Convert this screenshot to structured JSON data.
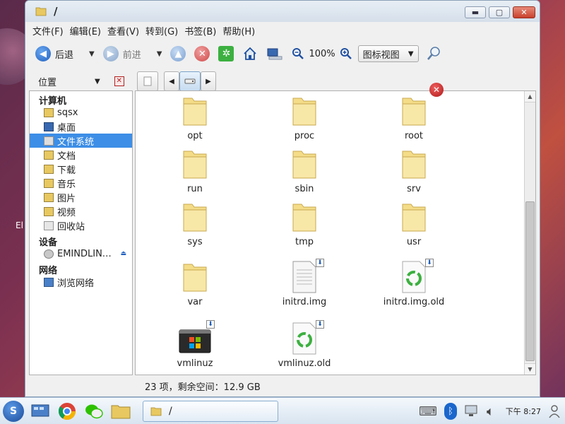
{
  "desktop": {
    "label": "El"
  },
  "window": {
    "title": "/",
    "controls": {
      "minimize": "▬",
      "maximize": "▢",
      "close": "✕"
    }
  },
  "menu": {
    "items": [
      "文件(F)",
      "编辑(E)",
      "查看(V)",
      "转到(G)",
      "书签(B)",
      "帮助(H)"
    ]
  },
  "toolbar": {
    "back_label": "后退",
    "forward_label": "前进",
    "zoom_level": "100%",
    "view_mode": "图标视图"
  },
  "location": {
    "label": "位置"
  },
  "sidebar": {
    "sections": [
      {
        "header": "计算机",
        "items": [
          {
            "label": "sqsx",
            "icon": "home-folder-icon"
          },
          {
            "label": "桌面",
            "icon": "desktop-icon"
          },
          {
            "label": "文件系统",
            "icon": "drive-icon",
            "selected": true
          },
          {
            "label": "文档",
            "icon": "documents-folder-icon"
          },
          {
            "label": "下载",
            "icon": "downloads-folder-icon"
          },
          {
            "label": "音乐",
            "icon": "music-folder-icon"
          },
          {
            "label": "图片",
            "icon": "pictures-folder-icon"
          },
          {
            "label": "视频",
            "icon": "videos-folder-icon"
          },
          {
            "label": "回收站",
            "icon": "trash-icon"
          }
        ]
      },
      {
        "header": "设备",
        "items": [
          {
            "label": "EMINDLIN…",
            "icon": "cdrom-icon",
            "eject": true
          }
        ]
      },
      {
        "header": "网络",
        "items": [
          {
            "label": "浏览网络",
            "icon": "network-icon"
          }
        ]
      }
    ]
  },
  "files": [
    {
      "name": "opt",
      "type": "folder"
    },
    {
      "name": "proc",
      "type": "folder"
    },
    {
      "name": "root",
      "type": "folder",
      "badge": "no-access"
    },
    {
      "name": "run",
      "type": "folder"
    },
    {
      "name": "sbin",
      "type": "folder"
    },
    {
      "name": "srv",
      "type": "folder"
    },
    {
      "name": "sys",
      "type": "folder"
    },
    {
      "name": "tmp",
      "type": "folder"
    },
    {
      "name": "usr",
      "type": "folder"
    },
    {
      "name": "var",
      "type": "folder"
    },
    {
      "name": "initrd.img",
      "type": "doc-link"
    },
    {
      "name": "initrd.img.old",
      "type": "recycle-link"
    },
    {
      "name": "vmlinuz",
      "type": "exe-link"
    },
    {
      "name": "vmlinuz.old",
      "type": "recycle-link"
    }
  ],
  "status": {
    "text": "23 项，剩余空间：12.9 GB"
  },
  "taskbar": {
    "window_title": "/",
    "clock": "下午 8:27"
  }
}
